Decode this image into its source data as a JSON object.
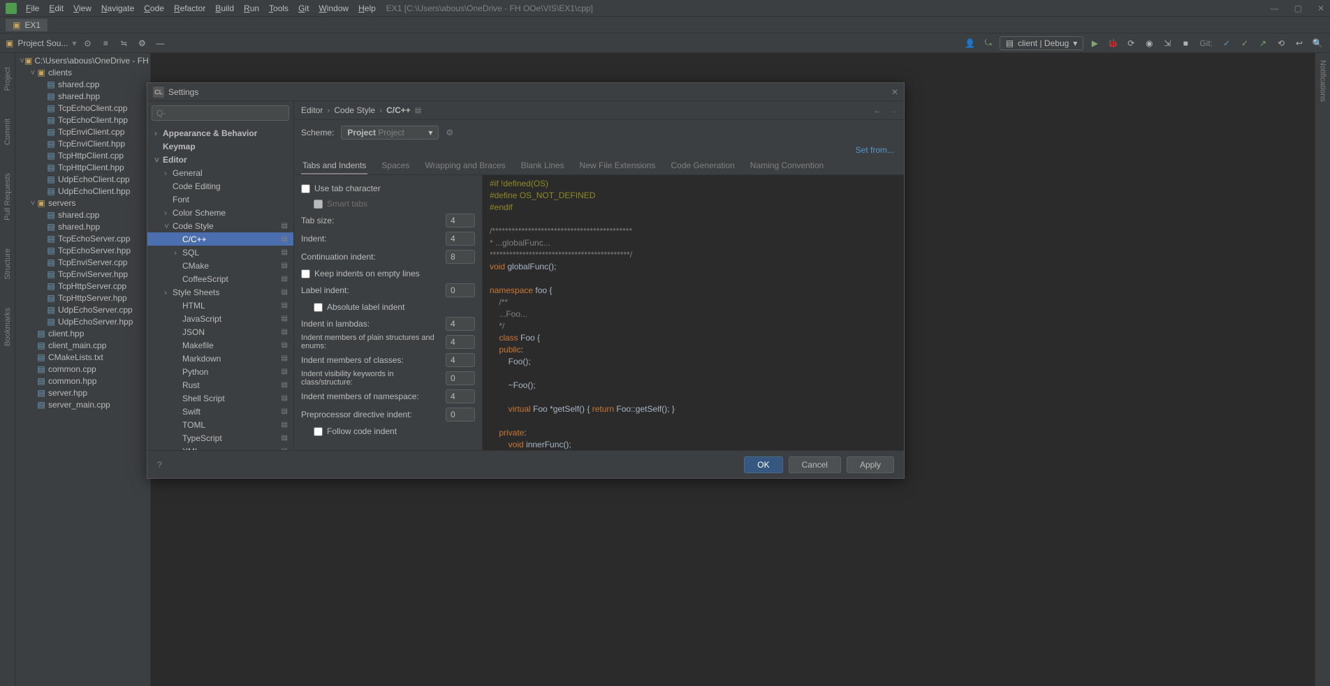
{
  "menubar": {
    "items": [
      "File",
      "Edit",
      "View",
      "Navigate",
      "Code",
      "Refactor",
      "Build",
      "Run",
      "Tools",
      "Git",
      "Window",
      "Help"
    ],
    "title_path": "EX1 [C:\\Users\\abous\\OneDrive - FH OOe\\VIS\\EX1\\cpp]"
  },
  "open_tab": "EX1",
  "toolbar": {
    "project_label": "Project Sou...",
    "run_config": "client | Debug",
    "git_label": "Git:"
  },
  "left_gutter": [
    "Project",
    "Commit",
    "Pull Requests",
    "Structure",
    "Bookmarks"
  ],
  "right_gutter": [
    "Notifications"
  ],
  "project_tree": {
    "root": "C:\\Users\\abous\\OneDrive - FH OOe\\V",
    "folders": [
      {
        "name": "clients",
        "files": [
          "shared.cpp",
          "shared.hpp",
          "TcpEchoClient.cpp",
          "TcpEchoClient.hpp",
          "TcpEnviClient.cpp",
          "TcpEnviClient.hpp",
          "TcpHttpClient.cpp",
          "TcpHttpClient.hpp",
          "UdpEchoClient.cpp",
          "UdpEchoClient.hpp"
        ]
      },
      {
        "name": "servers",
        "files": [
          "shared.cpp",
          "shared.hpp",
          "TcpEchoServer.cpp",
          "TcpEchoServer.hpp",
          "TcpEnviServer.cpp",
          "TcpEnviServer.hpp",
          "TcpHttpServer.cpp",
          "TcpHttpServer.hpp",
          "UdpEchoServer.cpp",
          "UdpEchoServer.hpp"
        ]
      }
    ],
    "root_files": [
      "client.hpp",
      "client_main.cpp",
      "CMakeLists.txt",
      "common.cpp",
      "common.hpp",
      "server.hpp",
      "server_main.cpp"
    ]
  },
  "dialog": {
    "title": "Settings",
    "search_placeholder": "",
    "search_icon": "Q-",
    "breadcrumb": [
      "Editor",
      "Code Style",
      "C/C++"
    ],
    "nav_back": "←",
    "nav_forward": "→",
    "nav": [
      {
        "label": "Appearance & Behavior",
        "level": 0,
        "caret": ">",
        "bold": true
      },
      {
        "label": "Keymap",
        "level": 0,
        "bold": true
      },
      {
        "label": "Editor",
        "level": 0,
        "caret": "v",
        "bold": true
      },
      {
        "label": "General",
        "level": 1,
        "caret": ">"
      },
      {
        "label": "Code Editing",
        "level": 1
      },
      {
        "label": "Font",
        "level": 1
      },
      {
        "label": "Color Scheme",
        "level": 1,
        "caret": ">"
      },
      {
        "label": "Code Style",
        "level": 1,
        "caret": "v",
        "cfg": true
      },
      {
        "label": "C/C++",
        "level": 2,
        "selected": true,
        "cfg": true
      },
      {
        "label": "SQL",
        "level": 2,
        "caret": ">",
        "cfg": true
      },
      {
        "label": "CMake",
        "level": 2,
        "cfg": true
      },
      {
        "label": "CoffeeScript",
        "level": 2,
        "cfg": true
      },
      {
        "label": "Style Sheets",
        "level": 1,
        "caret": ">",
        "cfg": true
      },
      {
        "label": "HTML",
        "level": 2,
        "cfg": true
      },
      {
        "label": "JavaScript",
        "level": 2,
        "cfg": true
      },
      {
        "label": "JSON",
        "level": 2,
        "cfg": true
      },
      {
        "label": "Makefile",
        "level": 2,
        "cfg": true
      },
      {
        "label": "Markdown",
        "level": 2,
        "cfg": true
      },
      {
        "label": "Python",
        "level": 2,
        "cfg": true
      },
      {
        "label": "Rust",
        "level": 2,
        "cfg": true
      },
      {
        "label": "Shell Script",
        "level": 2,
        "cfg": true
      },
      {
        "label": "Swift",
        "level": 2,
        "cfg": true
      },
      {
        "label": "TOML",
        "level": 2,
        "cfg": true
      },
      {
        "label": "TypeScript",
        "level": 2,
        "cfg": true
      },
      {
        "label": "XML",
        "level": 2,
        "cfg": true
      }
    ],
    "scheme_label": "Scheme:",
    "scheme_value_bold": "Project",
    "scheme_value_rest": "Project",
    "set_from": "Set from...",
    "tabs": [
      "Tabs and Indents",
      "Spaces",
      "Wrapping and Braces",
      "Blank Lines",
      "New File Extensions",
      "Code Generation",
      "Naming Convention"
    ],
    "form": {
      "use_tab": "Use tab character",
      "smart_tabs": "Smart tabs",
      "tab_size_lbl": "Tab size:",
      "tab_size": "4",
      "indent_lbl": "Indent:",
      "indent": "4",
      "cont_lbl": "Continuation indent:",
      "cont": "8",
      "keep_empty": "Keep indents on empty lines",
      "label_indent_lbl": "Label indent:",
      "label_indent": "0",
      "abs_label": "Absolute label indent",
      "lambda_lbl": "Indent in lambdas:",
      "lambda": "4",
      "plain_lbl": "Indent members of plain structures and enums:",
      "plain": "4",
      "classes_lbl": "Indent members of classes:",
      "classes": "4",
      "vis_lbl": "Indent visibility keywords in class/structure:",
      "vis": "0",
      "ns_lbl": "Indent members of namespace:",
      "ns": "4",
      "pp_lbl": "Preprocessor directive indent:",
      "pp": "0",
      "follow": "Follow code indent"
    },
    "buttons": {
      "ok": "OK",
      "cancel": "Cancel",
      "apply": "Apply"
    },
    "help_icon": "?"
  },
  "preview_code": [
    {
      "t": "mac",
      "s": "#if !defined(OS)"
    },
    {
      "t": "mac",
      "s": "#define OS_NOT_DEFINED"
    },
    {
      "t": "mac",
      "s": "#endif"
    },
    {
      "t": "blank",
      "s": ""
    },
    {
      "t": "cmt",
      "s": "/*******************************************"
    },
    {
      "t": "cmt",
      "s": "* ...globalFunc..."
    },
    {
      "t": "cmt",
      "s": "*******************************************/"
    },
    {
      "t": "mix",
      "parts": [
        {
          "c": "kw",
          "s": "void "
        },
        {
          "c": "ident",
          "s": "globalFunc();"
        }
      ]
    },
    {
      "t": "blank",
      "s": ""
    },
    {
      "t": "mix",
      "parts": [
        {
          "c": "kw",
          "s": "namespace "
        },
        {
          "c": "ident",
          "s": "foo {"
        }
      ]
    },
    {
      "t": "mix",
      "parts": [
        {
          "c": "guide",
          "s": "    "
        },
        {
          "c": "cmt",
          "s": "/**"
        }
      ]
    },
    {
      "t": "mix",
      "parts": [
        {
          "c": "guide",
          "s": "    "
        },
        {
          "c": "cmt",
          "s": "...Foo..."
        }
      ]
    },
    {
      "t": "mix",
      "parts": [
        {
          "c": "guide",
          "s": "    "
        },
        {
          "c": "cmt",
          "s": "*/"
        }
      ]
    },
    {
      "t": "mix",
      "parts": [
        {
          "c": "guide",
          "s": "    "
        },
        {
          "c": "kw",
          "s": "class "
        },
        {
          "c": "ident",
          "s": "Foo {"
        }
      ]
    },
    {
      "t": "mix",
      "parts": [
        {
          "c": "guide",
          "s": "    "
        },
        {
          "c": "kw",
          "s": "public"
        },
        {
          "c": "ident",
          "s": ":"
        }
      ]
    },
    {
      "t": "mix",
      "parts": [
        {
          "c": "guide",
          "s": "        "
        },
        {
          "c": "ident",
          "s": "Foo();"
        }
      ]
    },
    {
      "t": "blank",
      "s": ""
    },
    {
      "t": "mix",
      "parts": [
        {
          "c": "guide",
          "s": "        "
        },
        {
          "c": "ident",
          "s": "~Foo();"
        }
      ]
    },
    {
      "t": "blank",
      "s": ""
    },
    {
      "t": "mix",
      "parts": [
        {
          "c": "guide",
          "s": "        "
        },
        {
          "c": "kw",
          "s": "virtual "
        },
        {
          "c": "ident",
          "s": "Foo *getSelf() { "
        },
        {
          "c": "kw",
          "s": "return "
        },
        {
          "c": "ident",
          "s": "Foo::getSelf(); }"
        }
      ]
    },
    {
      "t": "blank",
      "s": ""
    },
    {
      "t": "mix",
      "parts": [
        {
          "c": "guide",
          "s": "    "
        },
        {
          "c": "kw",
          "s": "private"
        },
        {
          "c": "ident",
          "s": ":"
        }
      ]
    },
    {
      "t": "mix",
      "parts": [
        {
          "c": "guide",
          "s": "        "
        },
        {
          "c": "kw",
          "s": "void "
        },
        {
          "c": "ident",
          "s": "innerFunc();"
        }
      ]
    }
  ]
}
